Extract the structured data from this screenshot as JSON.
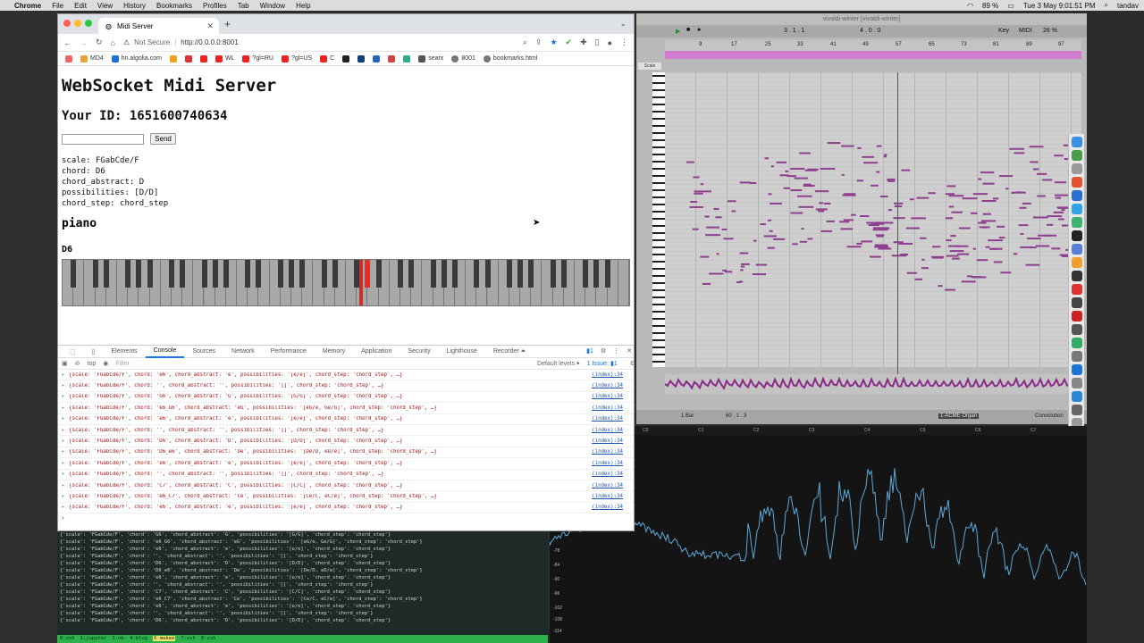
{
  "menubar": {
    "app": "Chrome",
    "items": [
      "File",
      "Edit",
      "View",
      "History",
      "Bookmarks",
      "Profiles",
      "Tab",
      "Window",
      "Help"
    ],
    "battery": "89 %",
    "datetime": "Tue 3 May  9:01:51 PM",
    "user": "tandav"
  },
  "browser": {
    "tab_title": "Midi Server",
    "url_prefix": "Not Secure",
    "url": "http://0.0.0.0:8001",
    "bookmarks": [
      "MD4",
      "hn.algolia.com",
      "WL",
      "?gl=RU",
      "?gl=US",
      "C",
      "searx",
      "8001",
      "bookmarks.html"
    ]
  },
  "page": {
    "title": "WebSocket Midi Server",
    "your_id": "Your ID: 1651600740634",
    "input_value": "",
    "send_label": "Send",
    "info_lines": [
      "scale: FGabCde/F",
      "chord: D6",
      "chord_abstract: D",
      "possibilities: [D/D]",
      "chord_step: chord_step"
    ],
    "instrument": "piano",
    "current_chord": "D6",
    "active_key_fraction": 0.52
  },
  "devtools": {
    "tabs": [
      "Elements",
      "Console",
      "Sources",
      "Network",
      "Performance",
      "Memory",
      "Application",
      "Security",
      "Lighthouse",
      "Recorder ⏶"
    ],
    "active_tab": "Console",
    "context": "top",
    "filter_placeholder": "Filter",
    "levels": "Default levels ▾",
    "issues": "1 Issue: ▮1",
    "badge": "▮1",
    "source": "(index):34",
    "logs": [
      "{scale: 'FGabCde/F', chord: 'e6', chord_abstract: 'e', possibilities: '[e/e]', chord_step: 'chord_step', …}",
      "{scale: 'FGabCde/F', chord: '', chord_abstract: '', possibilities: '[]', chord_step: 'chord_step', …}",
      "{scale: 'FGabCde/F', chord: 'G6', chord_abstract: 'G', possibilities: '[G/G]', chord_step: 'chord_step', …}",
      "{scale: 'FGabCde/F', chord: 'e6_G6', chord_abstract: 'eG', possibilities: '[eG/e, Ge/G]', chord_step: 'chord_step', …}",
      "{scale: 'FGabCde/F', chord: 'e6', chord_abstract: 'e', possibilities: '[e/e]', chord_step: 'chord_step', …}",
      "{scale: 'FGabCde/F', chord: '', chord_abstract: '', possibilities: '[]', chord_step: 'chord_step', …}",
      "{scale: 'FGabCde/F', chord: 'D6', chord_abstract: 'D', possibilities: '[D/D]', chord_step: 'chord_step', …}",
      "{scale: 'FGabCde/F', chord: 'D6_e6', chord_abstract: 'De', possibilities: '[De/D, eD/e]', chord_step: 'chord_step', …}",
      "{scale: 'FGabCde/F', chord: 'e6', chord_abstract: 'e', possibilities: '[e/e]', chord_step: 'chord_step', …}",
      "{scale: 'FGabCde/F', chord: '', chord_abstract: '', possibilities: '[]', chord_step: 'chord_step', …}",
      "{scale: 'FGabCde/F', chord: 'C7', chord_abstract: 'C', possibilities: '[C/C]', chord_step: 'chord_step', …}",
      "{scale: 'FGabCde/F', chord: 'e6_C7', chord_abstract: 'Ce', possibilities: '[Ce/C, eC/e]', chord_step: 'chord_step', …}",
      "{scale: 'FGabCde/F', chord: 'e6', chord_abstract: 'e', possibilities: '[e/e]', chord_step: 'chord_step', …}"
    ]
  },
  "ableton": {
    "title": "vivaldi-winter  [vivaldi-winter]",
    "scale_label": "Scale",
    "ruler": [
      "9",
      "17",
      "25",
      "33",
      "41",
      "49",
      "57",
      "65",
      "73",
      "81",
      "89",
      "97"
    ],
    "transport": "3 . 1 . 1",
    "loop": "4 . 0 . 0",
    "key_label": "Key",
    "midi_label": "MIDI",
    "cpu": "26 %",
    "device": "1-ACME Organ",
    "convolution": "Convolution",
    "bar_label": "1 Bar",
    "zoom": "60 . 1 . 3"
  },
  "spectrum": {
    "notes": [
      "C0",
      "C1",
      "C2",
      "C3",
      "C4",
      "C5",
      "C6",
      "C7"
    ],
    "db_labels": [
      "-78",
      "-84",
      "-90",
      "-96",
      "-102",
      "-108",
      "-114"
    ]
  },
  "terminal": {
    "lines": [
      "{'scale': 'FGabCde/F', 'chord': 'G6', 'chord_abstract': 'G', 'possibilities': '[G/G]', 'chord_step': 'chord_step'}",
      "{'scale': 'FGabCde/F', 'chord': 'e6_G6', 'chord_abstract': 'eG', 'possibilities': '[eG/e, Ge/G]', 'chord_step': 'chord_step'}",
      "{'scale': 'FGabCde/F', 'chord': 'e6', 'chord_abstract': 'e', 'possibilities': '[e/e]', 'chord_step': 'chord_step'}",
      "{'scale': 'FGabCde/F', 'chord': '', 'chord_abstract': '', 'possibilities': '[]', 'chord_step': 'chord_step'}",
      "{'scale': 'FGabCde/F', 'chord': 'D6', 'chord_abstract': 'D', 'possibilities': '[D/D]', 'chord_step': 'chord_step'}",
      "{'scale': 'FGabCde/F', 'chord': 'D6_e6', 'chord_abstract': 'De', 'possibilities': '[De/D, eD/e]', 'chord_step': 'chord_step'}",
      "{'scale': 'FGabCde/F', 'chord': 'e6', 'chord_abstract': 'e', 'possibilities': '[e/e]', 'chord_step': 'chord_step'}",
      "{'scale': 'FGabCde/F', 'chord': '', 'chord_abstract': '', 'possibilities': '[]', 'chord_step': 'chord_step'}",
      "{'scale': 'FGabCde/F', 'chord': 'C7', 'chord_abstract': 'C', 'possibilities': '[C/C]', 'chord_step': 'chord_step'}",
      "{'scale': 'FGabCde/F', 'chord': 'e6_C7', 'chord_abstract': 'Ce', 'possibilities': '[Ce/C, eC/e]', 'chord_step': 'chord_step'}",
      "{'scale': 'FGabCde/F', 'chord': 'e6', 'chord_abstract': 'e', 'possibilities': '[e/e]', 'chord_step': 'chord_step'}",
      "{'scale': 'FGabCde/F', 'chord': '', 'chord_abstract': '', 'possibilities': '[]', 'chord_step': 'chord_step'}",
      "{'scale': 'FGabCde/F', 'chord': 'D6', 'chord_abstract': 'D', 'possibilities': '[D/D]', 'chord_step': 'chord_step'}"
    ],
    "tmux_windows": [
      "0:zsh",
      "1:jupyter",
      "3:nb- 4:blog",
      "6:makee",
      "7:zsh",
      "8:zsh"
    ],
    "tmux_active": "6:makee"
  }
}
